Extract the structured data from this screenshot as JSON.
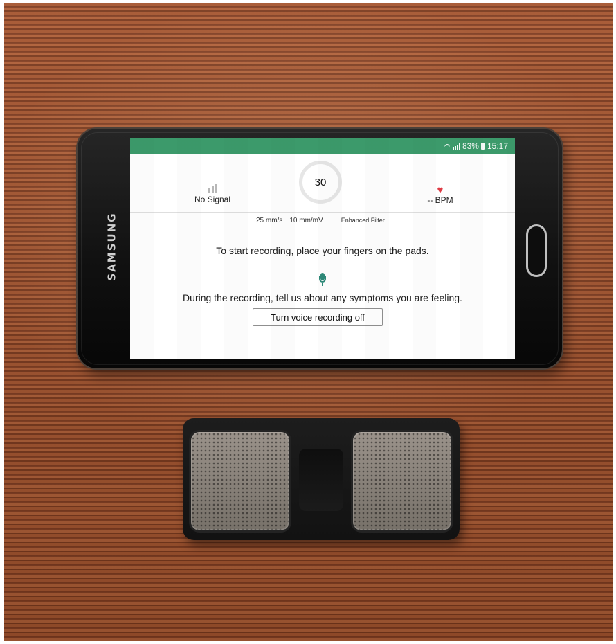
{
  "photo": {
    "phone": {
      "brand": "SAMSUNG",
      "status_bar": {
        "battery_percent": "83%",
        "time": "15:17"
      },
      "ecg_app": {
        "signal_label": "No Signal",
        "countdown": "30",
        "bpm_label": "-- BPM",
        "paper_speed": "25 mm/s",
        "gain": "10 mm/mV",
        "filter_label": "Enhanced Filter",
        "instruction": "To start recording, place your fingers on the pads.",
        "symptoms_prompt": "During the recording, tell us about any symptoms you are feeling.",
        "voice_button_label": "Turn voice recording off"
      }
    },
    "device": {},
    "colors": {
      "status_green": "#3c9a6b",
      "heart_red": "#df3b44",
      "mic_green": "#2e8a79"
    },
    "icons": [
      "wifi-icon",
      "signal-bars-icon",
      "battery-icon",
      "signal-meter-icon",
      "heart-icon",
      "microphone-icon"
    ]
  }
}
